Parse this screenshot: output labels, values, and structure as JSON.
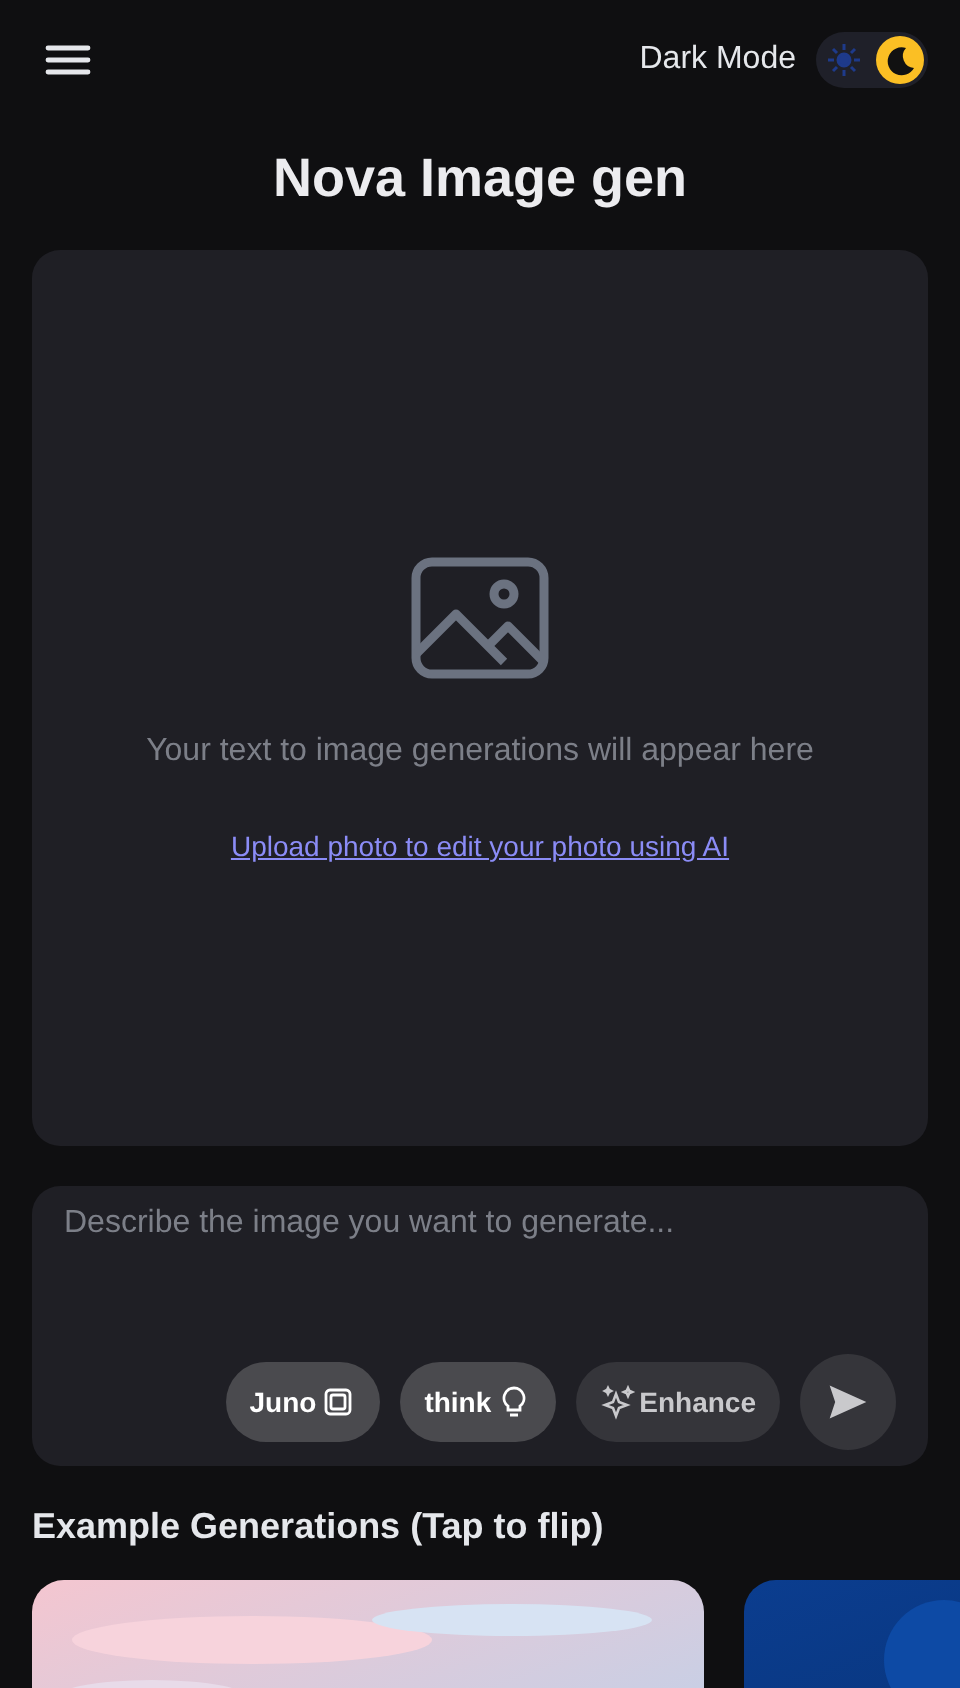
{
  "header": {
    "dark_mode_label": "Dark Mode",
    "dark_mode": {
      "on": true
    }
  },
  "title": "Nova Image gen",
  "preview": {
    "message": "Your text to image generations will appear here",
    "upload_link": "Upload photo to edit your photo using AI"
  },
  "prompt": {
    "placeholder": "Describe the image you want to generate...",
    "chips": [
      {
        "label": "Juno",
        "kind": "chip-icon",
        "selected": true
      },
      {
        "label": "think",
        "kind": "bulb",
        "selected": true
      },
      {
        "label": "Enhance",
        "kind": "sparkle",
        "selected": false
      }
    ]
  },
  "examples": {
    "heading": "Example Generations (Tap to flip)"
  }
}
